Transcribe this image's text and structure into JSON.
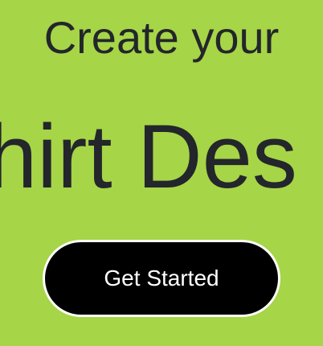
{
  "hero": {
    "line1": "Create your",
    "line2": "hirt Des",
    "cta_label": "Get Started"
  },
  "colors": {
    "background": "#a6d547",
    "headline_text": "#23262b",
    "button_fill": "#000000",
    "button_border": "#ffffff",
    "button_text": "#ffffff"
  }
}
